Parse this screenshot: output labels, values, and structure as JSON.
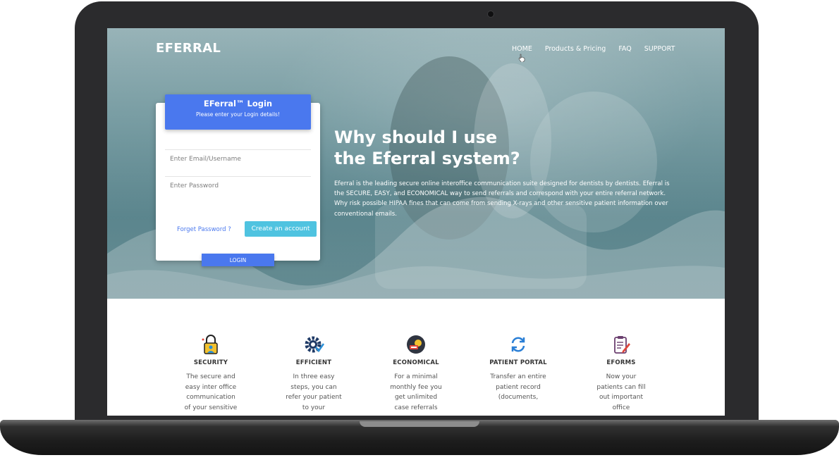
{
  "brand": "EFERRAL",
  "nav": {
    "items": [
      {
        "label": "HOME"
      },
      {
        "label": "Products & Pricing"
      },
      {
        "label": "FAQ"
      },
      {
        "label": "SUPPORT"
      }
    ]
  },
  "login": {
    "title": "EFerral™ Login",
    "subtitle": "Please enter your Login details!",
    "email_placeholder": "Enter Email/Username",
    "password_placeholder": "Enter Password",
    "forgot_label": "Forget Password ?",
    "create_label": "Create an account",
    "login_label": "LOGIN"
  },
  "hero": {
    "heading_line1": "Why should I use",
    "heading_line2": "the Eferral system?",
    "paragraph": "Eferral is the leading secure online interoffice communication suite designed for dentists by dentists. Eferral is the SECURE, EASY, and ECONOMICAL way to send referrals and correspond with your entire referral network. Why risk possible HIPAA fines that can come from sending X-rays and other sensitive patient information over conventional emails."
  },
  "features": [
    {
      "icon": "lock-user-icon",
      "title": "SECURITY",
      "text": "The secure and easy inter office communication of your sensitive"
    },
    {
      "icon": "gear-check-icon",
      "title": "EFFICIENT",
      "text": "In three easy steps, you can refer your patient to your"
    },
    {
      "icon": "money-icon",
      "title": "ECONOMICAL",
      "text": "For a minimal monthly fee you get unlimited case referrals"
    },
    {
      "icon": "sync-icon",
      "title": "PATIENT PORTAL",
      "text": "Transfer an entire patient record (documents,"
    },
    {
      "icon": "clipboard-edit-icon",
      "title": "EFORMS",
      "text": "Now your patients can fill out important office"
    }
  ],
  "colors": {
    "primary": "#4a78ee",
    "accent": "#4fc3e0",
    "hero_tint": "#6f959b"
  }
}
